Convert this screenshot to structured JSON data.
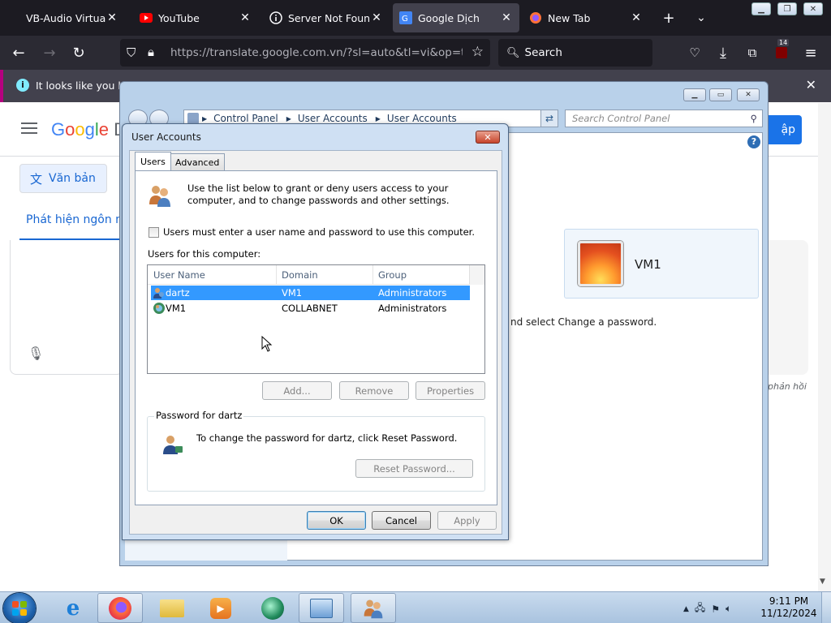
{
  "browser": {
    "tabs": [
      {
        "label": "VB-Audio Virtual Ap",
        "icon": "vb-audio-icon"
      },
      {
        "label": "YouTube",
        "icon": "youtube-icon"
      },
      {
        "label": "Server Not Found",
        "icon": "info-icon"
      },
      {
        "label": "Google Dịch",
        "icon": "google-translate-icon",
        "active": true
      },
      {
        "label": "New Tab",
        "icon": "firefox-icon"
      }
    ],
    "url": "https://translate.google.com.vn/?sl=auto&tl=vi&op=transl",
    "search_placeholder": "Search",
    "extension_badge": "14",
    "notification": "It looks like you hav"
  },
  "translate_page": {
    "logo": "Google D",
    "signin": "ập",
    "text_button": "Văn bản",
    "detect_language": "Phát hiện ngôn ng",
    "feedback": "phản hồi"
  },
  "control_panel": {
    "breadcrumb": [
      "Control Panel",
      "User Accounts",
      "User Accounts"
    ],
    "search_placeholder": "Search Control Panel",
    "account_name": "VM1",
    "change_password_hint": "nd select Change a password."
  },
  "dialog": {
    "title": "User Accounts",
    "tabs": [
      "Users",
      "Advanced"
    ],
    "intro": "Use the list below to grant or deny users access to your computer, and to change passwords and other settings.",
    "require_password_label": "Users must enter a user name and password to use this computer.",
    "require_password_checked": false,
    "users_label": "Users for this computer:",
    "columns": [
      "User Name",
      "Domain",
      "Group"
    ],
    "users": [
      {
        "name": "dartz",
        "domain": "VM1",
        "group": "Administrators",
        "selected": true
      },
      {
        "name": "VM1",
        "domain": "COLLABNET",
        "group": "Administrators",
        "selected": false
      }
    ],
    "add_button": "Add...",
    "remove_button": "Remove",
    "properties_button": "Properties",
    "password_group_label": "Password for dartz",
    "password_text": "To change the password for dartz, click Reset Password.",
    "reset_password_button": "Reset Password...",
    "ok_button": "OK",
    "cancel_button": "Cancel",
    "apply_button": "Apply"
  },
  "taskbar": {
    "time": "9:11 PM",
    "date": "11/12/2024"
  }
}
